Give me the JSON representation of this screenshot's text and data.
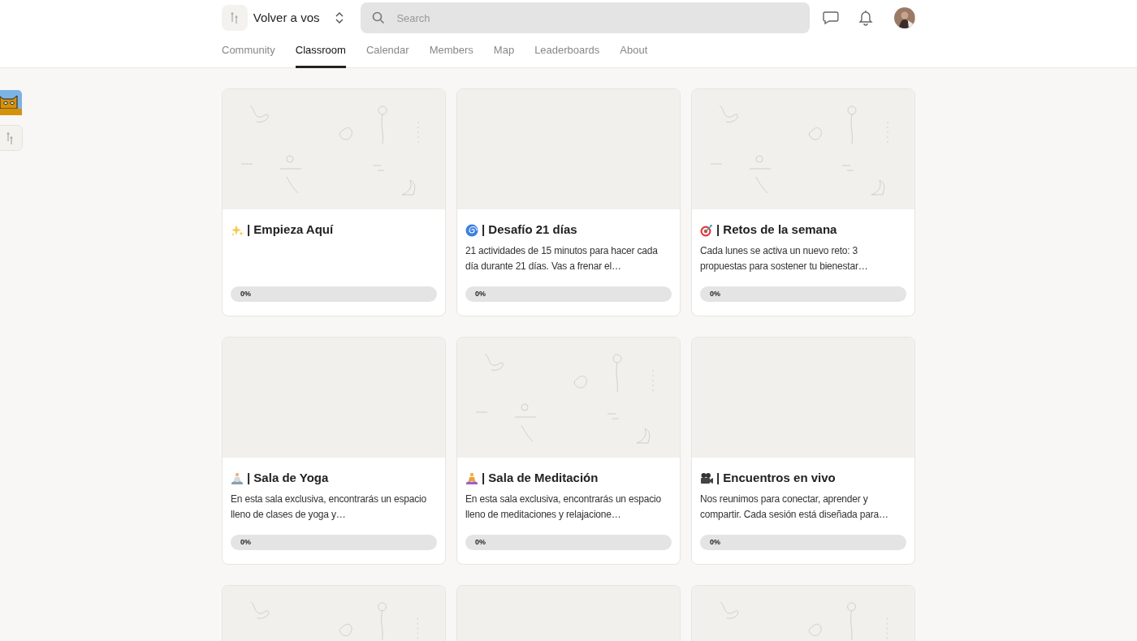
{
  "community": {
    "name": "Volver a vos"
  },
  "search": {
    "placeholder": "Search"
  },
  "tabs": [
    {
      "label": "Community",
      "selected": false
    },
    {
      "label": "Classroom",
      "selected": true
    },
    {
      "label": "Calendar",
      "selected": false
    },
    {
      "label": "Members",
      "selected": false
    },
    {
      "label": "Map",
      "selected": false
    },
    {
      "label": "Leaderboards",
      "selected": false
    },
    {
      "label": "About",
      "selected": false
    }
  ],
  "courses": [
    {
      "cover": {
        "kind": "picture"
      },
      "emoji": {
        "kind": "sparkles"
      },
      "title": "| Empieza Aquí",
      "progress": {
        "level": 0,
        "reading": "0%"
      }
    },
    {
      "cover": {
        "kind": "plain"
      },
      "emoji": {
        "kind": "spiral"
      },
      "title": "| Desafío 21 días",
      "description": "21 actividades de 15 minutos para hacer cada día durante 21 días. Vas a frenar el…",
      "progress": {
        "level": 0,
        "reading": "0%"
      }
    },
    {
      "cover": {
        "kind": "picture"
      },
      "emoji": {
        "kind": "target"
      },
      "title": "| Retos de la semana",
      "description": "Cada lunes se activa un nuevo reto: 3 propuestas para sostener tu bienestar…",
      "progress": {
        "level": 0,
        "reading": "0%"
      }
    },
    {
      "cover": {
        "kind": "plain"
      },
      "emoji": {
        "kind": "yoga"
      },
      "title": "| Sala de Yoga",
      "description": "En esta sala exclusiva, encontrarás un espacio lleno de clases de yoga y…",
      "progress": {
        "level": 0,
        "reading": "0%"
      }
    },
    {
      "cover": {
        "kind": "picture"
      },
      "emoji": {
        "kind": "meditation"
      },
      "title": "| Sala de Meditación",
      "description": "En esta sala exclusiva, encontrarás un espacio lleno de meditaciones y relajacione…",
      "progress": {
        "level": 0,
        "reading": "0%"
      }
    },
    {
      "cover": {
        "kind": "plain"
      },
      "emoji": {
        "kind": "camera"
      },
      "title": "| Encuentros en vivo",
      "description": "Nos reunimos para conectar, aprender y compartir. Cada sesión está diseñada para…",
      "progress": {
        "level": 0,
        "reading": "0%"
      }
    },
    {
      "cover": {
        "kind": "picture"
      }
    },
    {
      "cover": {
        "kind": "plain"
      }
    },
    {
      "cover": {
        "kind": "picture"
      }
    }
  ]
}
